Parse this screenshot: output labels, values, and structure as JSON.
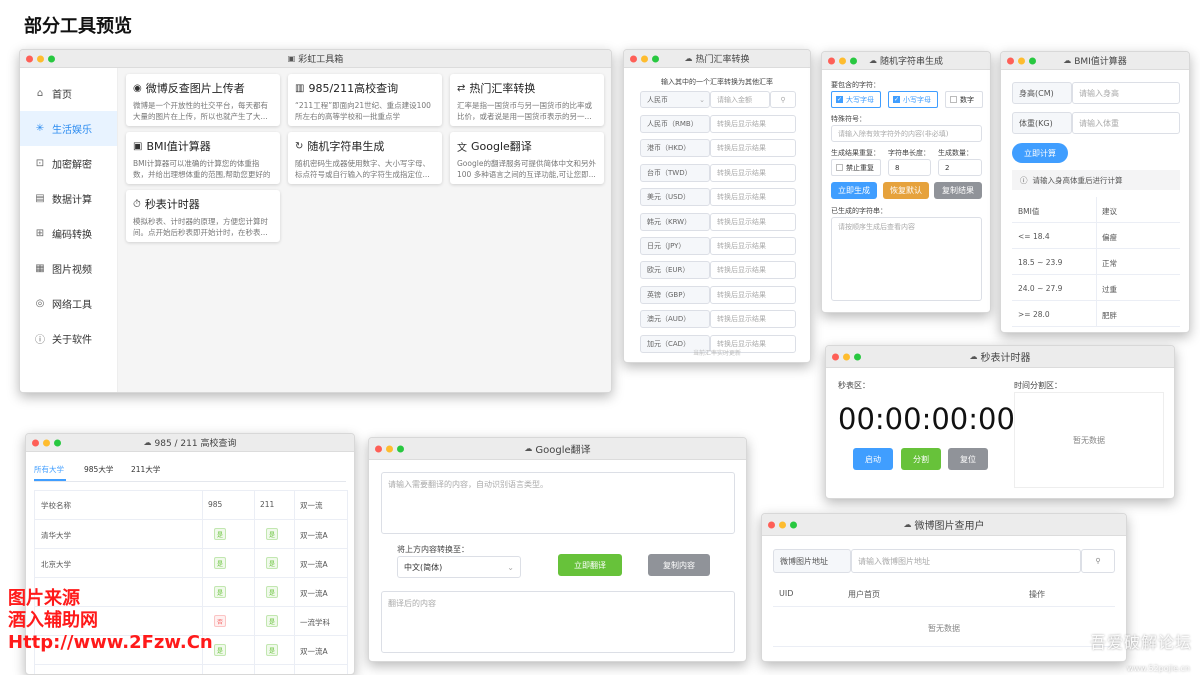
{
  "heading": "部分工具预览",
  "main": {
    "title": "彩虹工具箱",
    "nav": [
      "首页",
      "生活娱乐",
      "加密解密",
      "数据计算",
      "编码转换",
      "图片视频",
      "网络工具",
      "关于软件"
    ],
    "nav_icons": [
      "home-icon",
      "sparkle-icon",
      "lock-icon",
      "calculator-icon",
      "code-icon",
      "image-icon",
      "globe-icon",
      "info-icon"
    ],
    "cards": [
      {
        "name": "微博反查图片上传者",
        "icon": "weibo-icon",
        "desc": "微博是一个开放性的社交平台，每天都有大量的图片在上传，所以也就产生了大..."
      },
      {
        "name": "985/211高校查询",
        "icon": "building-icon",
        "desc": "“211工程”即面向21世纪、重点建设100所左右的高等学校和一批重点学科。“985..."
      },
      {
        "name": "热门汇率转换",
        "icon": "exchange-icon",
        "desc": "汇率是指一国货币与另一国货币的比率或比价，或者说是用一国货币表示的另一..."
      },
      {
        "name": "BMI值计算器",
        "icon": "scale-icon",
        "desc": "BMI计算器可以准确的计算您的体重指数，并给出理想体重的范围,帮助您更好的了..."
      },
      {
        "name": "随机字符串生成",
        "icon": "refresh-icon",
        "desc": "随机密码生成器使用数字、大小写字母、标点符号或自行输入的字符生成指定位..."
      },
      {
        "name": "Google翻译",
        "icon": "translate-icon",
        "desc": "Google的翻译服务可提供简体中文和另外100 多种语言之间的互译功能,可让您即..."
      },
      {
        "name": "秒表计时器",
        "icon": "stopwatch-icon",
        "desc": "模拟秒表、计时器的原理，方便您计算时间。点开始后秒表即开始计时，在秒表..."
      }
    ]
  },
  "currency": {
    "title": "热门汇率转换",
    "hint": "输入其中的一个汇率转换为其他汇率",
    "select": "人民币",
    "amount_placeholder": "请输入金额",
    "rows": [
      "人民币（RMB）",
      "港币（HKD）",
      "台币（TWD）",
      "美元（USD）",
      "韩元（KRW）",
      "日元（JPY）",
      "欧元（EUR）",
      "英镑（GBP）",
      "澳元（AUD）",
      "加元（CAD）"
    ],
    "result_placeholder": "转换后显示结果",
    "footer": "当前汇率实时更新"
  },
  "randstr": {
    "title": "随机字符串生成",
    "contains_label": "要包含的字符：",
    "opts": [
      "大写字母",
      "小写字母",
      "数字"
    ],
    "special_label": "特殊符号：",
    "special_placeholder": "请输入除有效字符外的内容(非必填)",
    "dup_label": "生成结果重复：",
    "len_label": "字符串长度：",
    "count_label": "生成数量：",
    "dup_opt": "禁止重复",
    "len_value": "8",
    "count_value": "2",
    "btn_gen": "立即生成",
    "btn_reset": "恢复默认",
    "btn_copy": "复制结果",
    "result_label": "已生成的字符串：",
    "result_placeholder": "请按顺序生成后查看内容"
  },
  "bmi": {
    "title": "BMI值计算器",
    "height_label": "身高(CM)",
    "height_placeholder": "请输入身高",
    "weight_label": "体重(KG)",
    "weight_placeholder": "请输入体重",
    "btn": "立即计算",
    "notice": "请输入身高体重后进行计算",
    "headers": [
      "BMI值",
      "建议"
    ],
    "rows": [
      [
        "<= 18.4",
        "偏瘦"
      ],
      [
        "18.5 ~ 23.9",
        "正常"
      ],
      [
        "24.0 ~ 27.9",
        "过重"
      ],
      [
        ">= 28.0",
        "肥胖"
      ]
    ]
  },
  "stopwatch": {
    "title": "秒表计时器",
    "left_label": "秒表区：",
    "right_label": "时间分割区：",
    "time": "00:00:00:00",
    "btn_start": "启动",
    "btn_split": "分割",
    "btn_reset": "复位",
    "empty": "暂无数据"
  },
  "college": {
    "title": "985 / 211 高校查询",
    "tabs": [
      "所有大学",
      "985大学",
      "211大学"
    ],
    "headers": [
      "学校名称",
      "985",
      "211",
      "双一流"
    ],
    "rows": [
      {
        "name": "清华大学",
        "t985": "是",
        "t211": "是",
        "dfc": "双一流A",
        "n985": false
      },
      {
        "name": "北京大学",
        "t985": "是",
        "t211": "是",
        "dfc": "双一流A",
        "n985": false
      },
      {
        "name": "",
        "t985": "是",
        "t211": "是",
        "dfc": "双一流A",
        "n985": false
      },
      {
        "name": "",
        "t985": "否",
        "t211": "是",
        "dfc": "一流学科",
        "n985": true
      },
      {
        "name": "",
        "t985": "是",
        "t211": "是",
        "dfc": "双一流A",
        "n985": false
      },
      {
        "name": "",
        "t985": "是",
        "t211": "是",
        "dfc": "双一流A",
        "n985": false
      }
    ]
  },
  "translate": {
    "title": "Google翻译",
    "input_placeholder": "请输入需要翻译的内容，自动识别语言类型。",
    "to_label": "将上方内容转换至：",
    "lang": "中文(简体)",
    "btn_translate": "立即翻译",
    "btn_copy": "复制内容",
    "output_placeholder": "翻译后的内容"
  },
  "weibo": {
    "title": "微博图片查用户",
    "addon": "微博图片地址",
    "placeholder": "请输入微博图片地址",
    "headers": [
      "UID",
      "用户首页",
      "操作"
    ],
    "empty": "暂无数据"
  },
  "watermark": {
    "line1": "图片来源",
    "line2": "酒入辅助网",
    "line3": "Http://www.2Fzw.Cn",
    "right": "吾爱破解论坛",
    "right_url": "www.52pojie.cn"
  }
}
